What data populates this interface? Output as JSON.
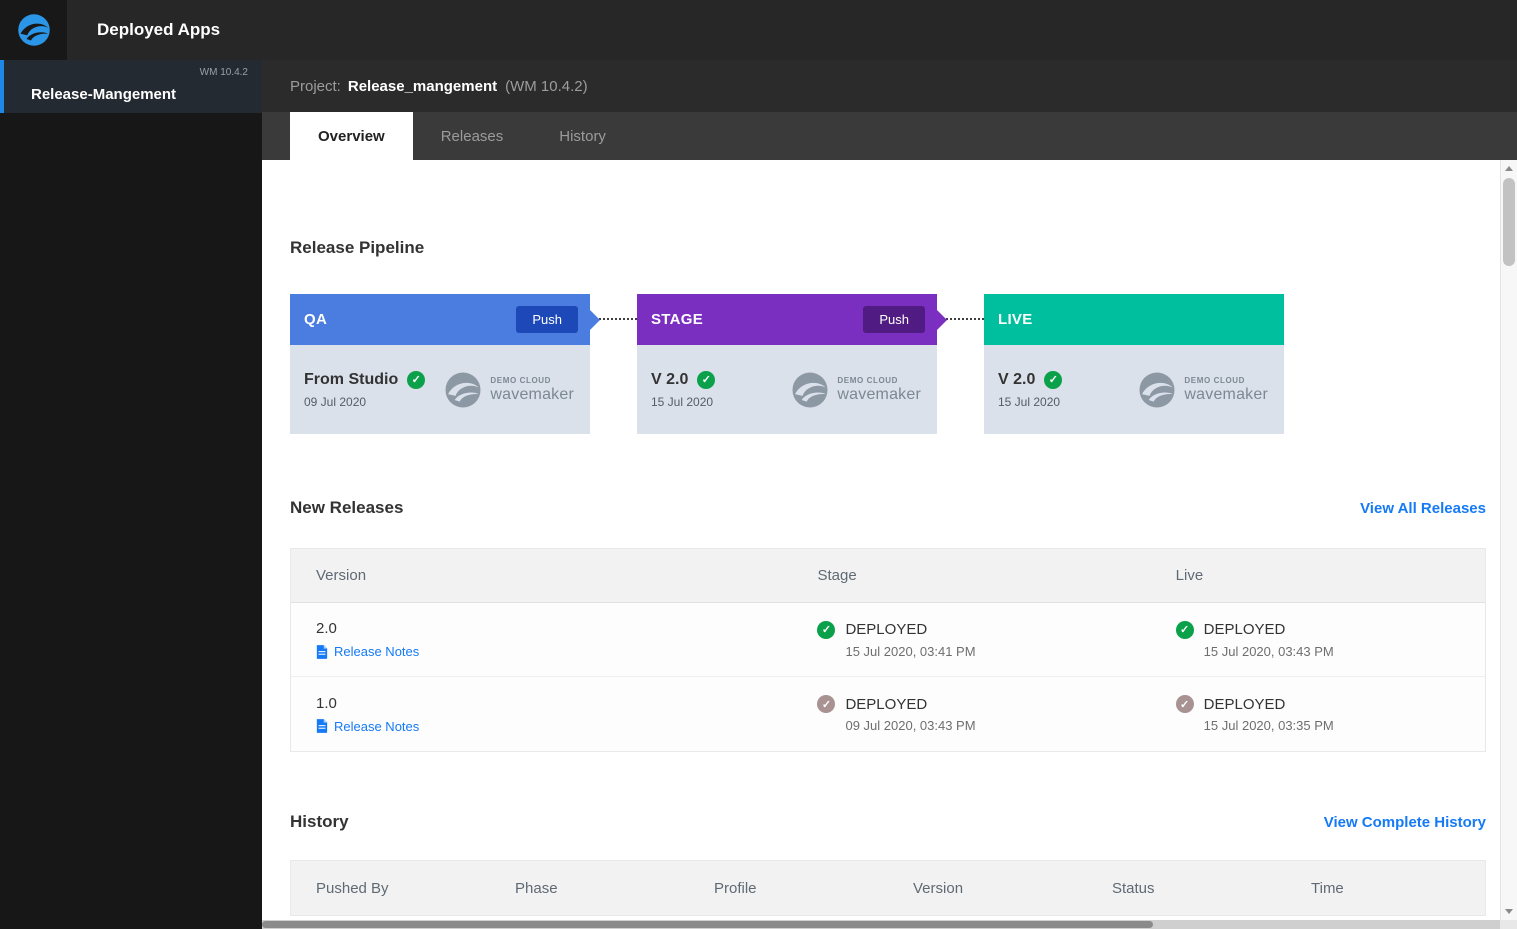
{
  "topbar": {
    "title": "Deployed Apps"
  },
  "sidebar": {
    "selected": {
      "label": "Release-Mangement",
      "version": "WM 10.4.2"
    }
  },
  "project_header": {
    "prefix": "Project:",
    "name": "Release_mangement",
    "version": "(WM 10.4.2)"
  },
  "tabs": [
    {
      "label": "Overview",
      "active": true
    },
    {
      "label": "Releases",
      "active": false
    },
    {
      "label": "History",
      "active": false
    }
  ],
  "pipeline": {
    "title": "Release Pipeline",
    "brand": {
      "line1": "DEMO CLOUD",
      "line2": "wavemaker"
    },
    "stages": [
      {
        "name": "QA",
        "push_label": "Push",
        "version": "From Studio",
        "date": "09 Jul 2020",
        "header_color": "#4b7ce0",
        "push_color": "#1d48b8",
        "check": "green"
      },
      {
        "name": "STAGE",
        "push_label": "Push",
        "version": "V 2.0",
        "date": "15 Jul 2020",
        "header_color": "#7b2fc0",
        "push_color": "#511b84",
        "check": "green"
      },
      {
        "name": "LIVE",
        "version": "V 2.0",
        "date": "15 Jul 2020",
        "header_color": "#00bf9f",
        "check": "green"
      }
    ]
  },
  "new_releases": {
    "title": "New Releases",
    "view_all_label": "View All Releases",
    "columns": [
      "Version",
      "Stage",
      "Live"
    ],
    "release_notes_label": "Release Notes",
    "rows": [
      {
        "version": "2.0",
        "stage": {
          "status": "DEPLOYED",
          "time": "15 Jul 2020, 03:41 PM",
          "check": "green"
        },
        "live": {
          "status": "DEPLOYED",
          "time": "15 Jul 2020, 03:43 PM",
          "check": "green"
        }
      },
      {
        "version": "1.0",
        "stage": {
          "status": "DEPLOYED",
          "time": "09 Jul 2020, 03:43 PM",
          "check": "gray"
        },
        "live": {
          "status": "DEPLOYED",
          "time": "15 Jul 2020, 03:35 PM",
          "check": "gray"
        }
      }
    ]
  },
  "history": {
    "title": "History",
    "view_all_label": "View Complete History",
    "columns": [
      "Pushed By",
      "Phase",
      "Profile",
      "Version",
      "Status",
      "Time"
    ]
  },
  "colors": {
    "link_blue": "#157af6",
    "check_green": "#0ba14a",
    "check_gray": "#a89292",
    "qa_header": "#4b7ce0",
    "stage_header": "#7b2fc0",
    "live_header": "#00bf9f"
  }
}
